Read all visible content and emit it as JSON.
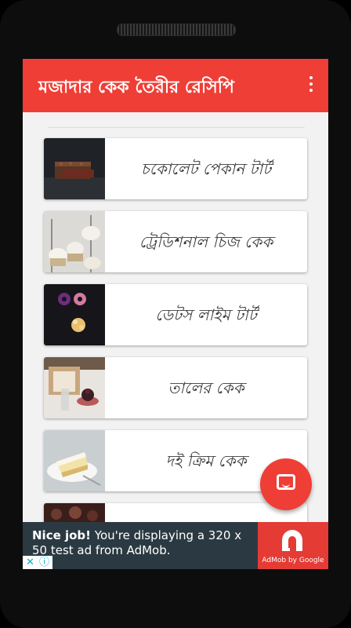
{
  "app": {
    "title": "মজাদার কেক তৈরীর রেসিপি",
    "accent": "#ef3e36"
  },
  "recipes": [
    {
      "label": "চকোলেট পেকান টার্ট",
      "image": "chocolate-tart-photo"
    },
    {
      "label": "ট্রেডিশনাল চিজ কেক",
      "image": "cheese-cake-photo"
    },
    {
      "label": "ডেটস লাইম টার্ট",
      "image": "dates-lime-tart-photo"
    },
    {
      "label": "তালের কেক",
      "image": "palm-cake-photo"
    },
    {
      "label": "দই ক্রিম কেক",
      "image": "yogurt-cream-cake-photo"
    },
    {
      "label": "",
      "image": "chocolate-cake-photo"
    }
  ],
  "fab": {
    "icon": "chat-icon"
  },
  "ad": {
    "headline": "Nice job!",
    "body": "You're displaying a 320 x 50 test ad from AdMob.",
    "brand": "AdMob by Google",
    "icons": [
      "close-x-icon",
      "info-icon"
    ]
  }
}
